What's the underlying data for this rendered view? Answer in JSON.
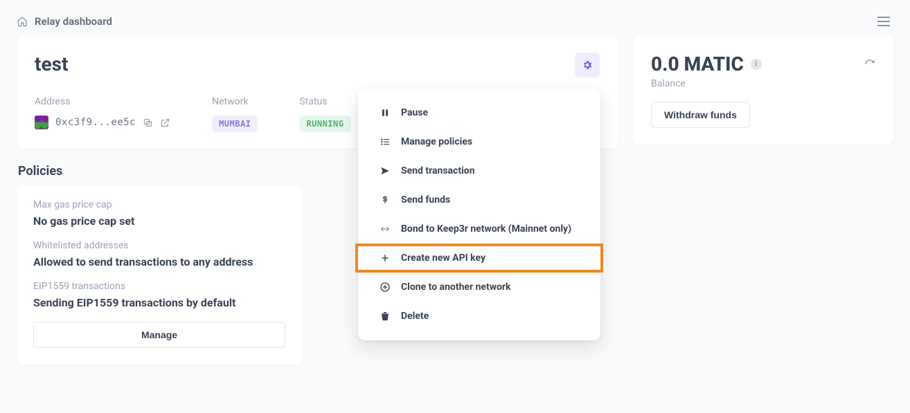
{
  "breadcrumb": {
    "title": "Relay dashboard"
  },
  "relayer": {
    "name": "test",
    "address_label": "Address",
    "address": "0xc3f9...ee5c",
    "network_label": "Network",
    "network_badge": "MUMBAI",
    "status_label": "Status",
    "status_badge": "RUNNING"
  },
  "policies": {
    "section_title": "Policies",
    "items": [
      {
        "label": "Max gas price cap",
        "value": "No gas price cap set"
      },
      {
        "label": "Whitelisted addresses",
        "value": "Allowed to send transactions to any address"
      },
      {
        "label": "EIP1559 transactions",
        "value": "Sending EIP1559 transactions by default"
      }
    ],
    "manage_label": "Manage"
  },
  "balance": {
    "amount": "0.0 MATIC",
    "label": "Balance",
    "withdraw_label": "Withdraw funds"
  },
  "menu": {
    "items": [
      "Pause",
      "Manage policies",
      "Send transaction",
      "Send funds",
      "Bond to Keep3r network (Mainnet only)",
      "Create new API key",
      "Clone to another network",
      "Delete"
    ]
  }
}
